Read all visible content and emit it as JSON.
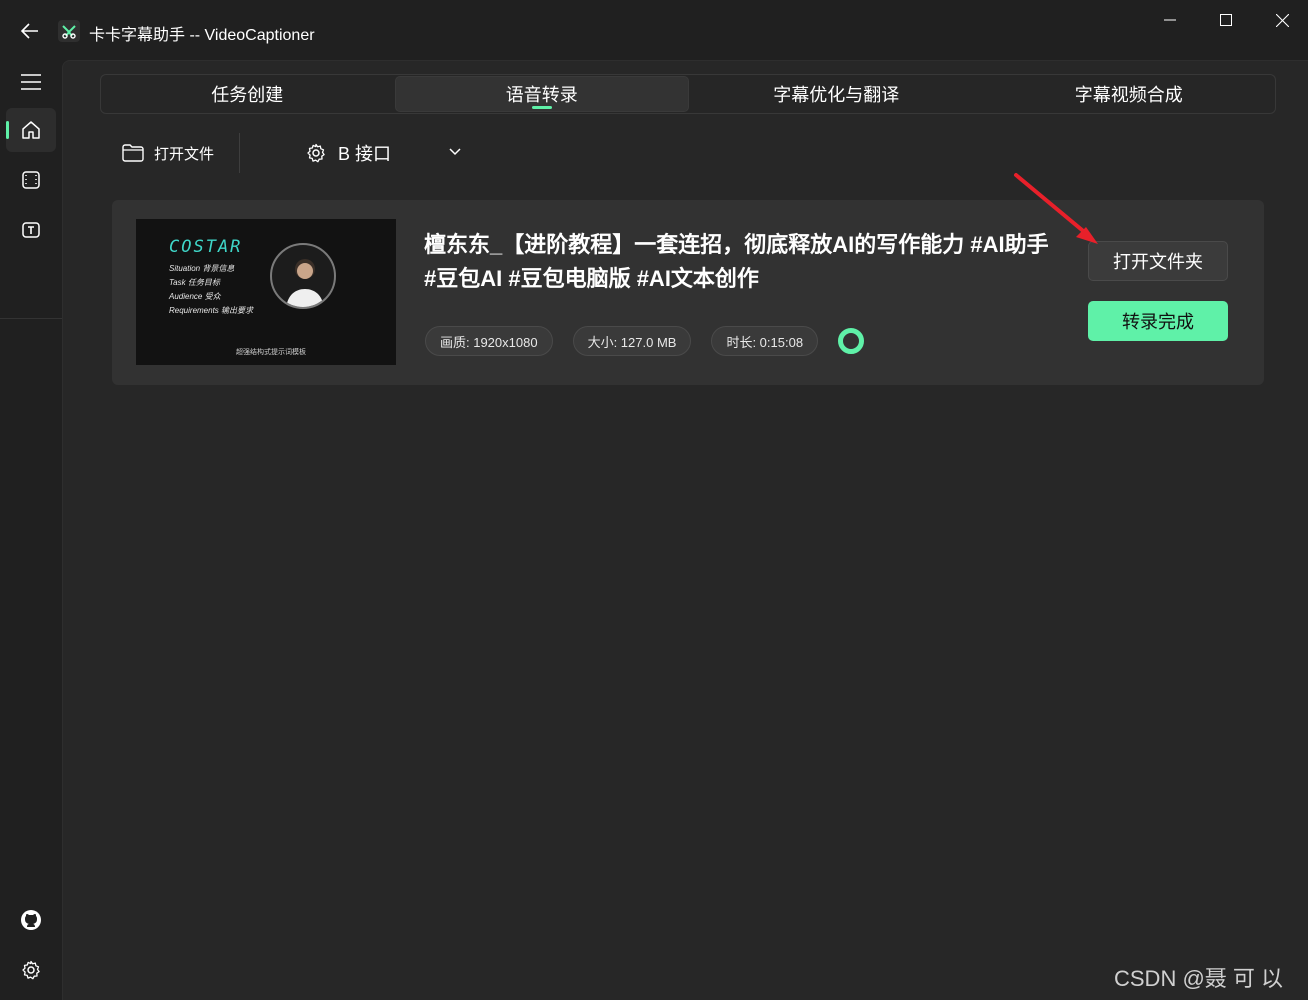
{
  "window": {
    "title": "卡卡字幕助手 -- VideoCaptioner"
  },
  "nav": {
    "items": [
      "menu-icon",
      "home-icon",
      "film-icon",
      "text-box-icon"
    ],
    "bottom": [
      "github-icon",
      "gear-icon"
    ]
  },
  "tabs": [
    {
      "label": "任务创建",
      "active": false
    },
    {
      "label": "语音转录",
      "active": true
    },
    {
      "label": "字幕优化与翻译",
      "active": false
    },
    {
      "label": "字幕视频合成",
      "active": false
    }
  ],
  "toolbar": {
    "open_file_label": "打开文件",
    "api_label": "B 接口"
  },
  "task": {
    "title": "檀东东_【进阶教程】一套连招，彻底释放AI的写作能力 #AI助手 #豆包AI #豆包电脑版 #AI文本创作",
    "resolution": "画质: 1920x1080",
    "size": "大小: 127.0 MB",
    "duration": "时长: 0:15:08",
    "open_folder_label": "打开文件夹",
    "status_label": "转录完成",
    "thumbnail": {
      "heading": "COSTAR",
      "lines": [
        "Situation 背景信息",
        "Task 任务目标",
        "Audience 受众",
        "Requirements 输出要求"
      ],
      "caption": "超强结构式提示词模板"
    }
  },
  "accent_color": "#5ff1a8",
  "watermark": "CSDN @聂 可 以"
}
